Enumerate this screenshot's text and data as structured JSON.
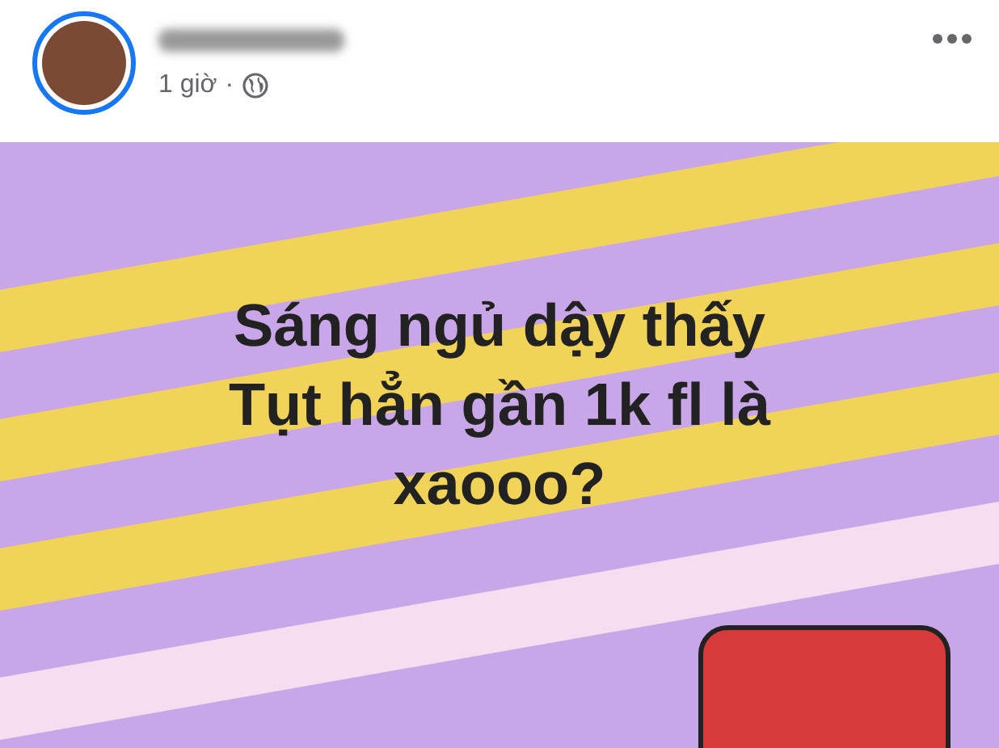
{
  "post": {
    "time": "1 giờ",
    "separator": "·"
  },
  "card": {
    "lines": [
      "Sáng ngủ dậy thấy",
      "Tụt hẳn gần 1k fl là",
      "xaooo?"
    ]
  }
}
